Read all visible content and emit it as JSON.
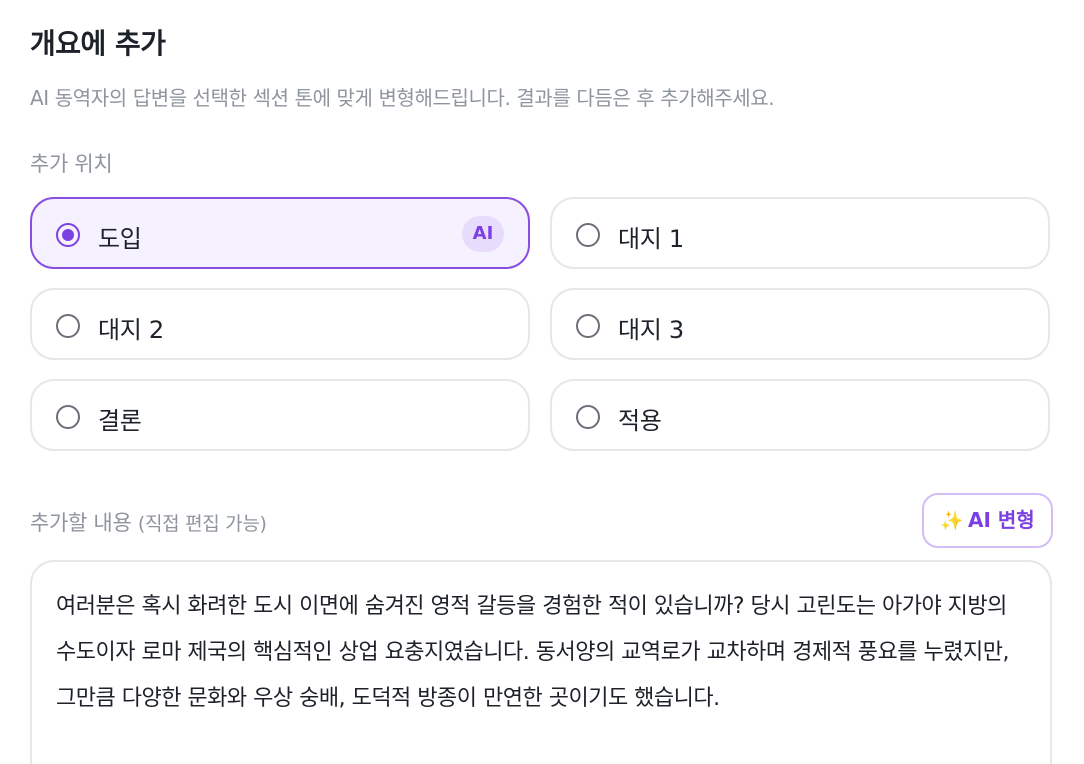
{
  "title": "개요에 추가",
  "subtitle": "AI 동역자의 답변을 선택한 섹션 톤에 맞게 변형해드립니다. 결과를 다듬은 후 추가해주세요.",
  "position_label": "추가 위치",
  "options": [
    {
      "label": "도입",
      "selected": true,
      "badge": "AI"
    },
    {
      "label": "대지 1",
      "selected": false
    },
    {
      "label": "대지 2",
      "selected": false
    },
    {
      "label": "대지 3",
      "selected": false
    },
    {
      "label": "결론",
      "selected": false
    },
    {
      "label": "적용",
      "selected": false
    }
  ],
  "content_label": "추가할 내용",
  "content_hint": "(직접 편집 가능)",
  "transform_button": {
    "icon": "sparkle-icon",
    "icon_glyph": "✨",
    "label": "AI 변형"
  },
  "content_text": "여러분은 혹시 화려한 도시 이면에 숨겨진 영적 갈등을 경험한 적이 있습니까? 당시 고린도는 아가야 지방의 수도이자 로마 제국의 핵심적인 상업 요충지였습니다. 동서양의 교역로가 교차하며 경제적 풍요를 누렸지만, 그만큼 다양한 문화와 우상 숭배, 도덕적 방종이 만연한 곳이기도 했습니다.",
  "colors": {
    "accent": "#7b3fe4",
    "selected_bg": "#f6f1fe",
    "border": "#e6e7ea",
    "muted_text": "#8f959e"
  }
}
